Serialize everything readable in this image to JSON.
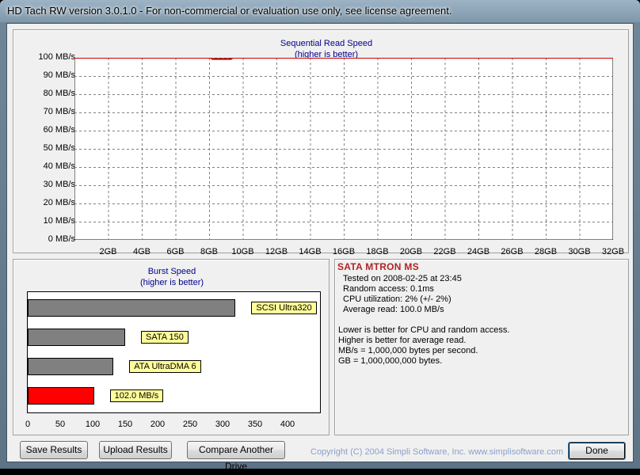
{
  "window": {
    "title": "HD Tach RW version 3.0.1.0  - For non-commercial or evaluation use only, see license agreement."
  },
  "colors": {
    "title_text": "#00008b",
    "grid_line": "#808080",
    "seq_line": "#cc0000",
    "bar_reference": "#808080",
    "bar_current": "#ff0000",
    "bar_label_bg": "#ffff99",
    "drive_name": "#b22222",
    "copyright": "#8da0c8"
  },
  "chart_data": [
    {
      "type": "line",
      "title": "Sequential Read Speed",
      "subtitle": "(higher is better)",
      "xlabel": "",
      "ylabel": "",
      "ylim": [
        0,
        100
      ],
      "xlim": [
        0,
        32
      ],
      "y_ticks": [
        "0 MB/s",
        "10 MB/s",
        "20 MB/s",
        "30 MB/s",
        "40 MB/s",
        "50 MB/s",
        "60 MB/s",
        "70 MB/s",
        "80 MB/s",
        "90 MB/s",
        "100 MB/s"
      ],
      "x_ticks": [
        "2GB",
        "4GB",
        "6GB",
        "8GB",
        "10GB",
        "12GB",
        "14GB",
        "16GB",
        "18GB",
        "20GB",
        "22GB",
        "24GB",
        "26GB",
        "28GB",
        "30GB",
        "32GB"
      ],
      "grid": true,
      "series": [
        {
          "x": [
            0,
            8.1,
            8.2,
            9.3,
            9.4,
            32
          ],
          "values": [
            100,
            100,
            99.3,
            99.3,
            100,
            100
          ]
        }
      ]
    },
    {
      "type": "bar",
      "orientation": "horizontal",
      "title": "Burst Speed",
      "subtitle": "(higher is better)",
      "xlim": [
        0,
        450
      ],
      "x_ticks": [
        "0",
        "50",
        "100",
        "150",
        "200",
        "250",
        "300",
        "350",
        "400"
      ],
      "categories": [
        "SCSI Ultra320",
        "SATA 150",
        "ATA UltraDMA 6",
        "102.0 MB/s"
      ],
      "values": [
        320,
        150,
        132,
        102
      ],
      "highlight_index": 3
    }
  ],
  "info": {
    "drive_name": "SATA MTRON MS",
    "lines": [
      "Tested on 2008-02-25 at 23:45",
      "Random access: 0.1ms",
      "CPU utilization: 2% (+/- 2%)",
      "Average read: 100.0 MB/s"
    ],
    "notes": [
      "Lower is better for CPU and random access.",
      "Higher is better for average read.",
      "MB/s = 1,000,000 bytes per second.",
      "GB = 1,000,000,000 bytes."
    ]
  },
  "buttons": {
    "save": "Save Results",
    "upload": "Upload Results",
    "compare": "Compare Another Drive",
    "done": "Done"
  },
  "copyright": "Copyright (C) 2004 Simpli Software, Inc. www.simplisoftware.com"
}
